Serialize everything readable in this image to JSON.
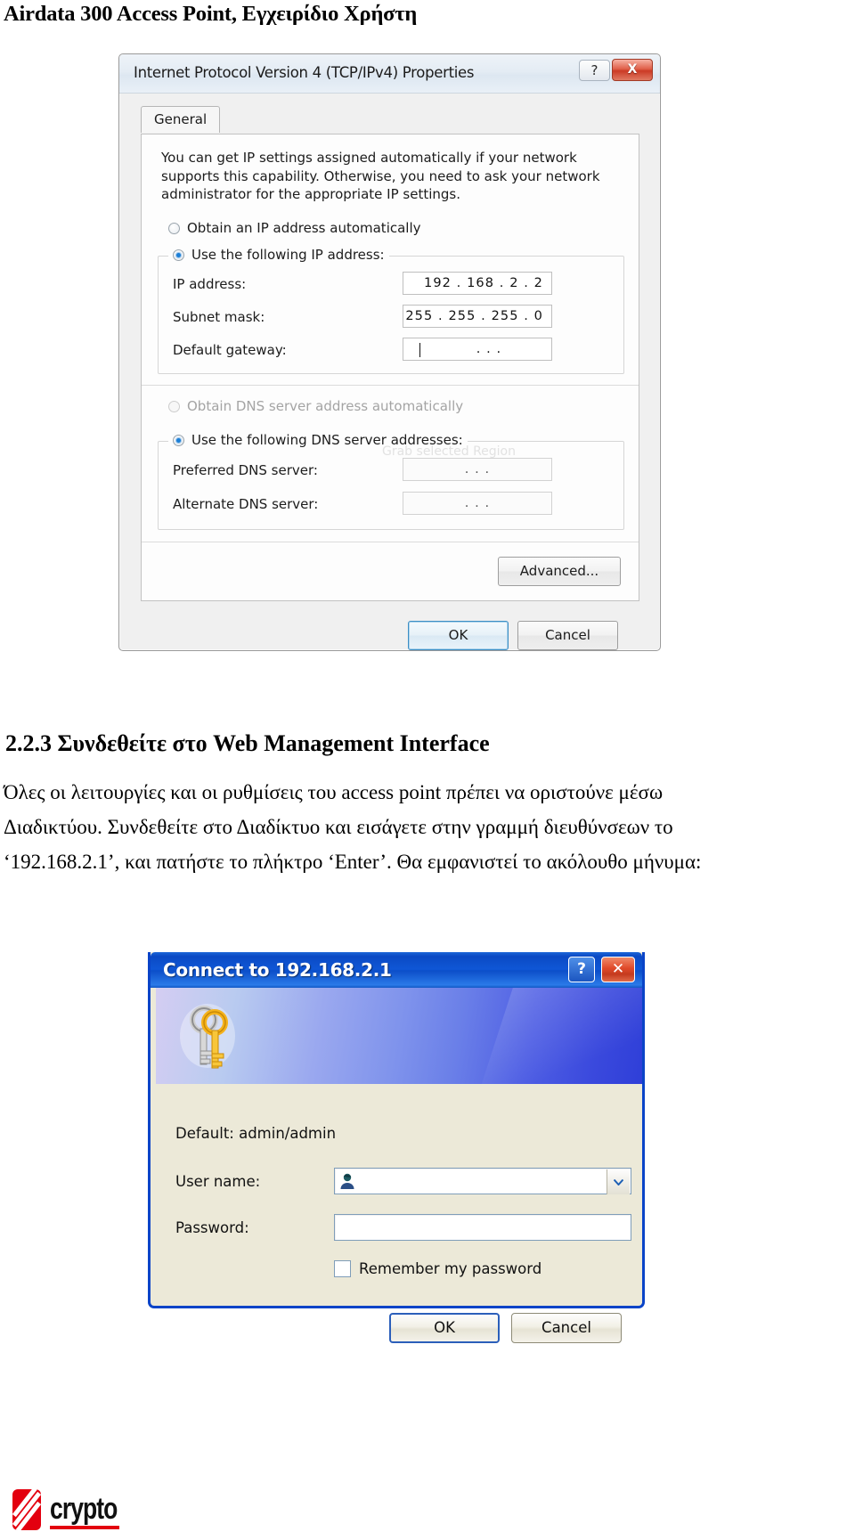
{
  "page": {
    "header_title": "Airdata 300 Access Point, Εγχειρίδιο Χρήστη"
  },
  "ipv4_dialog": {
    "title": "Internet Protocol Version 4 (TCP/IPv4) Properties",
    "help_button": "?",
    "close_button": "X",
    "tab": "General",
    "description": "You can get IP settings assigned automatically if your network supports this capability. Otherwise, you need to ask your network administrator for the appropriate IP settings.",
    "radio_auto_ip": "Obtain an IP address automatically",
    "radio_manual_ip": "Use the following IP address:",
    "label_ip": "IP address:",
    "value_ip": "192 . 168 .  2  .  2",
    "label_subnet": "Subnet mask:",
    "value_subnet": "255 . 255 . 255 .  0",
    "label_gateway": "Default gateway:",
    "value_gateway": ".     .     .",
    "radio_auto_dns": "Obtain DNS server address automatically",
    "radio_manual_dns": "Use the following DNS server addresses:",
    "label_preferred_dns": "Preferred DNS server:",
    "value_preferred_dns": ".     .     .",
    "label_alternate_dns": "Alternate DNS server:",
    "value_alternate_dns": ".     .     .",
    "button_advanced": "Advanced...",
    "button_ok": "OK",
    "button_cancel": "Cancel",
    "watermark": "Grab selected Region"
  },
  "section": {
    "heading": "2.2.3 Συνδεθείτε στο Web Management Interface",
    "paragraph_line1": "Όλες οι λειτουργίες και οι ρυθμίσεις του access point πρέπει να οριστούνε μέσω",
    "paragraph_line2": "Διαδικτύου. Συνδεθείτε στο Διαδίκτυο και εισάγετε στην γραμμή διευθύνσεων το",
    "paragraph_line3": "‘192.168.2.1’, και πατήστε το πλήκτρο ‘Enter’. Θα εμφανιστεί το ακόλουθο μήνυμα:"
  },
  "connect_dialog": {
    "title": "Connect to 192.168.2.1",
    "help_button": "?",
    "close_button": "✕",
    "default_hint": "Default: admin/admin",
    "label_username": "User name:",
    "value_username": "",
    "label_password": "Password:",
    "value_password": "",
    "checkbox_remember": "Remember my password",
    "button_ok": "OK",
    "button_cancel": "Cancel"
  },
  "footer": {
    "logo_text": "crypto"
  },
  "colors": {
    "brand_red": "#e3000f",
    "xp_title_blue": "#0b49c4",
    "win7_accent": "#1c7fd6"
  }
}
